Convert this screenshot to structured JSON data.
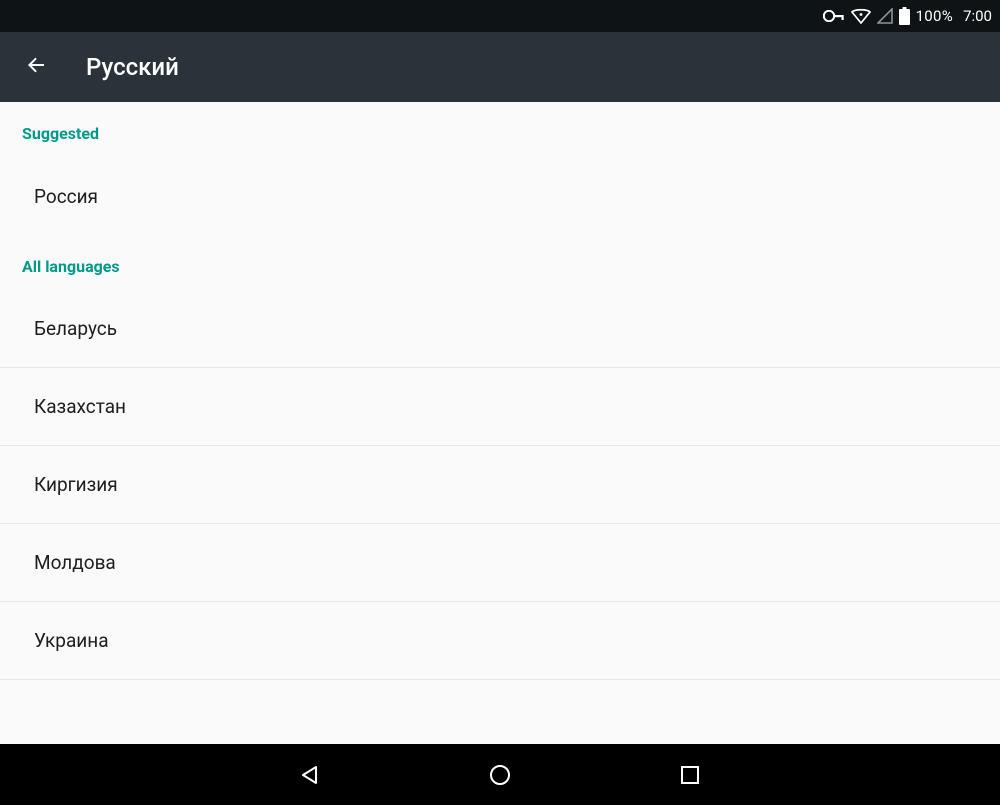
{
  "statusbar": {
    "battery_percent": "100%",
    "clock": "7:00"
  },
  "actionbar": {
    "title": "Русский"
  },
  "sections": {
    "suggested": {
      "header": "Suggested",
      "items": [
        "Россия"
      ]
    },
    "all": {
      "header": "All languages",
      "items": [
        "Беларусь",
        "Казахстан",
        "Киргизия",
        "Молдова",
        "Украина"
      ]
    }
  }
}
